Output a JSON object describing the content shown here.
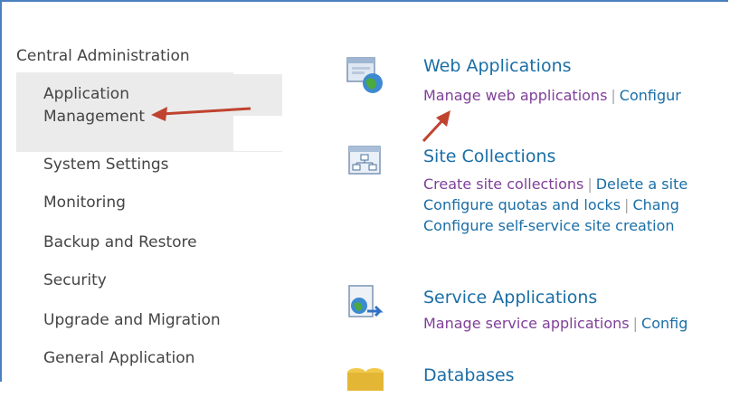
{
  "nav": {
    "root_label": "Central Administration",
    "items": [
      {
        "label": "Application Management",
        "selected": true
      },
      {
        "label": "System Settings"
      },
      {
        "label": "Monitoring"
      },
      {
        "label": "Backup and Restore"
      },
      {
        "label": "Security"
      },
      {
        "label": "Upgrade and Migration"
      },
      {
        "label": "General Application"
      }
    ]
  },
  "sections": [
    {
      "title": "Web Applications",
      "icon": "web-applications-icon",
      "links": [
        [
          "Manage web applications",
          "Configur"
        ]
      ]
    },
    {
      "title": "Site Collections",
      "icon": "site-collections-icon",
      "links": [
        [
          "Create site collections",
          "Delete a site"
        ],
        [
          "Configure quotas and locks",
          "Chang"
        ],
        [
          "Configure self-service site creation"
        ]
      ]
    },
    {
      "title": "Service Applications",
      "icon": "service-applications-icon",
      "links": [
        [
          "Manage service applications",
          "Config"
        ]
      ]
    },
    {
      "title": "Databases",
      "icon": "databases-icon",
      "links": []
    }
  ],
  "colors": {
    "frame_border": "#4a80bd",
    "link_visited": "#7f3f98",
    "link": "#1a6ea6",
    "annotation_arrow": "#c0432f",
    "selected_bg": "#ebebeb"
  }
}
